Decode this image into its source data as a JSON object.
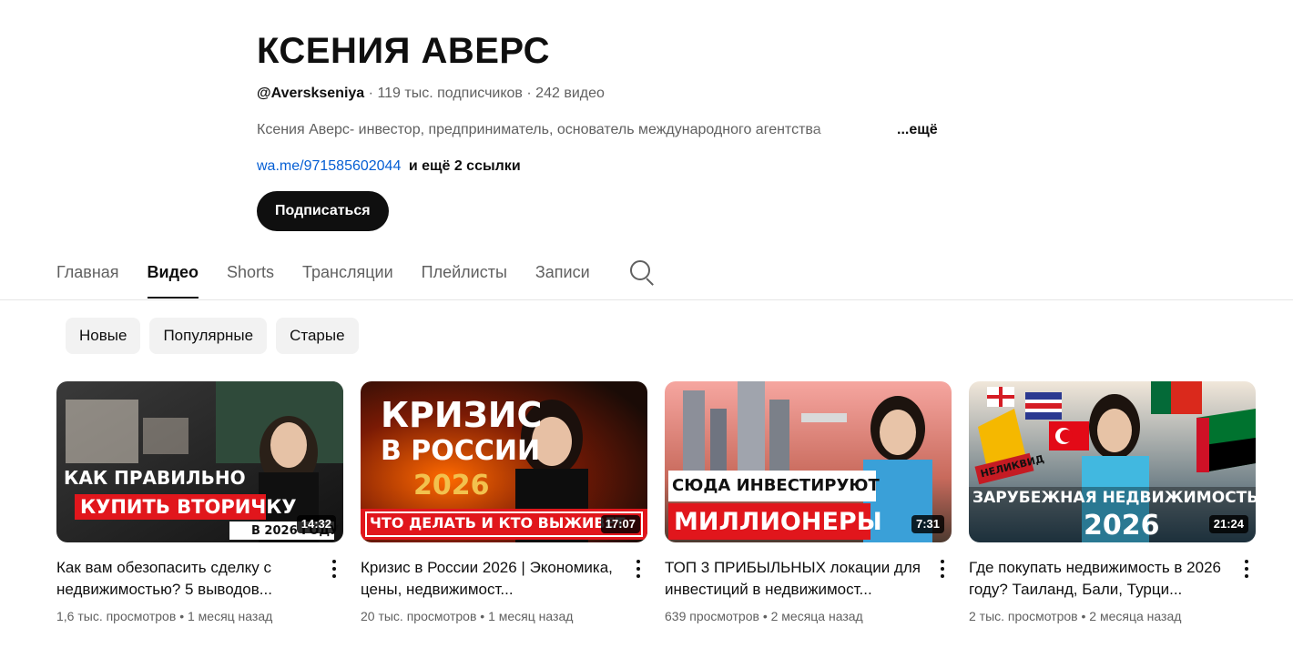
{
  "channel": {
    "name": "КСЕНИЯ АВЕРС",
    "handle": "@Averskseniya",
    "subscribers": "119 тыс. подписчиков",
    "video_count": "242 видео",
    "separator": "·",
    "description": "Ксения Аверс- инвестор, предприниматель, основатель международного агентства",
    "description_more": "...ещё",
    "link": "wa.me/971585602044",
    "more_links": "и ещё 2 ссылки",
    "subscribe_label": "Подписаться"
  },
  "tabs": [
    {
      "label": "Главная",
      "active": false
    },
    {
      "label": "Видео",
      "active": true
    },
    {
      "label": "Shorts",
      "active": false
    },
    {
      "label": "Трансляции",
      "active": false
    },
    {
      "label": "Плейлисты",
      "active": false
    },
    {
      "label": "Записи",
      "active": false
    }
  ],
  "filters": [
    "Новые",
    "Популярные",
    "Старые"
  ],
  "videos": [
    {
      "title": "Как вам обезопасить сделку с недвижимостью? 5 выводов...",
      "views": "1,6 тыс. просмотров",
      "age": "1 месяц назад",
      "duration": "14:32",
      "thumb_text": [
        "КАК ПРАВИЛЬНО",
        "КУПИТЬ ВТОРИЧКУ",
        "В 2026 ГОДУ"
      ]
    },
    {
      "title": "Кризис в России 2026 | Экономика, цены, недвижимост...",
      "views": "20 тыс. просмотров",
      "age": "1 месяц назад",
      "duration": "17:07",
      "thumb_text": [
        "КРИЗИС",
        "В РОССИИ",
        "2026",
        "ЧТО ДЕЛАТЬ И КТО ВЫЖИВЕТ"
      ]
    },
    {
      "title": "ТОП 3 ПРИБЫЛЬНЫХ локации для инвестиций в недвижимост...",
      "views": "639 просмотров",
      "age": "2 месяца назад",
      "duration": "7:31",
      "thumb_text": [
        "СЮДА ИНВЕСТИРУЮТ",
        "МИЛЛИОНЕРЫ"
      ]
    },
    {
      "title": "Где покупать недвижимость в 2026 году? Таиланд, Бали, Турци...",
      "views": "2 тыс. просмотров",
      "age": "2 месяца назад",
      "duration": "21:24",
      "thumb_text": [
        "НЕЛИКВИД",
        "ЗАРУБЕЖНАЯ НЕДВИЖИМОСТЬ",
        "2026"
      ]
    }
  ],
  "colors": {
    "link": "#065fd4",
    "subscribe_bg": "#0f0f0f",
    "chip_bg": "#f2f2f2",
    "thumb_red": "#e1161c"
  }
}
